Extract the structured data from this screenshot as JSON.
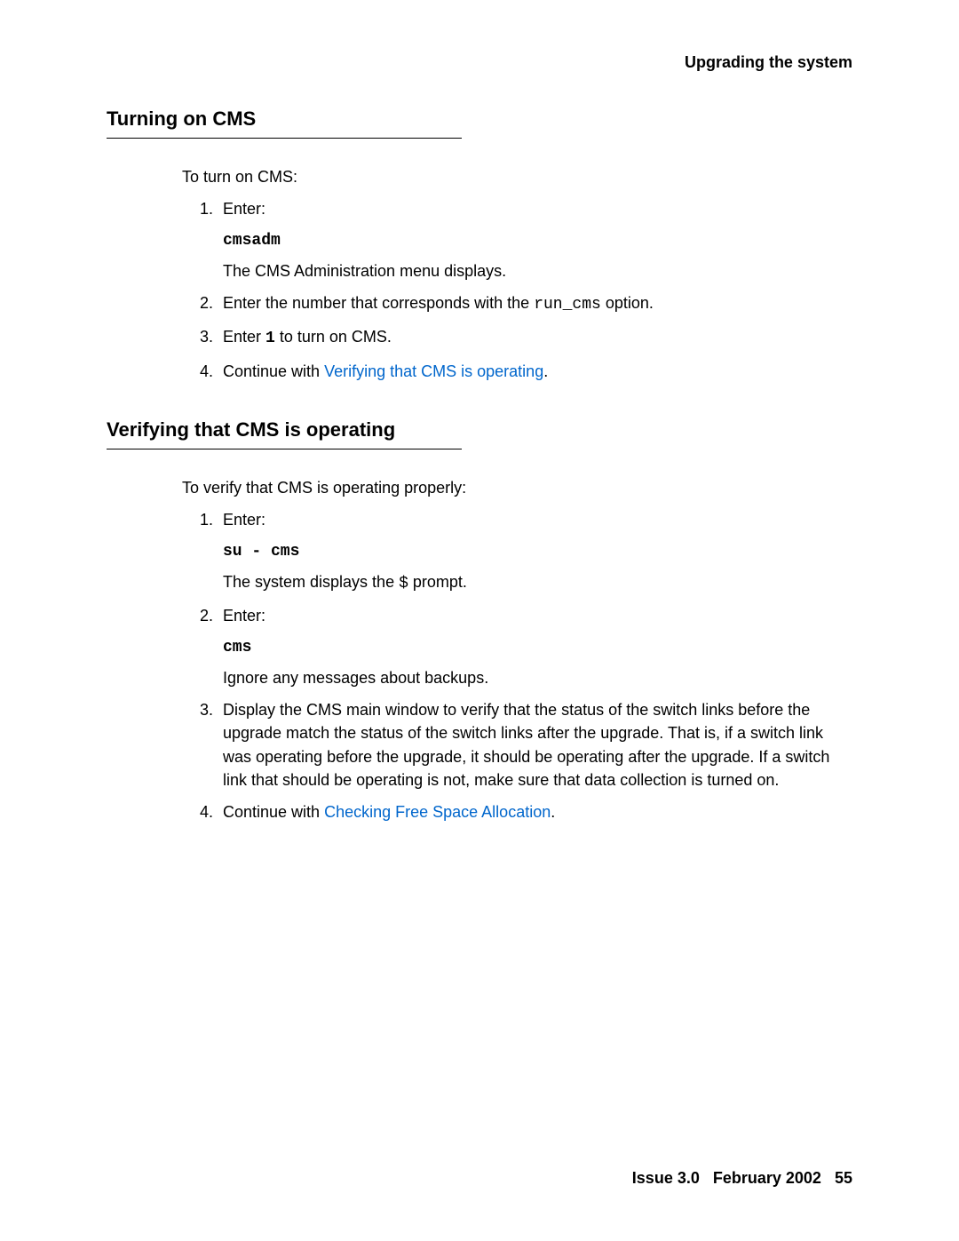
{
  "header": {
    "title": "Upgrading the system"
  },
  "s1": {
    "heading": "Turning on CMS",
    "intro": "To turn on CMS:",
    "i1": {
      "num": "1.",
      "text": "Enter:",
      "code": "cmsadm",
      "after": "The CMS Administration menu displays."
    },
    "i2": {
      "num": "2.",
      "pre": "Enter the number that corresponds with the ",
      "code": "run_cms",
      "post": " option."
    },
    "i3": {
      "num": "3.",
      "pre": "Enter ",
      "code": "1",
      "post": " to turn on CMS."
    },
    "i4": {
      "num": "4.",
      "pre": "Continue with ",
      "link": "Verifying that CMS is operating",
      "post": "."
    }
  },
  "s2": {
    "heading": "Verifying that CMS is operating",
    "intro": "To verify that CMS is operating properly:",
    "i1": {
      "num": "1.",
      "text": "Enter:",
      "code": "su - cms",
      "after_pre": "The system displays the ",
      "after_code": "$",
      "after_post": " prompt."
    },
    "i2": {
      "num": "2.",
      "text": "Enter:",
      "code": "cms",
      "after": "Ignore any messages about backups."
    },
    "i3": {
      "num": "3.",
      "text": "Display the CMS main window to verify that the status of the switch links before the upgrade match the status of the switch links after the upgrade. That is, if a switch link was operating before the upgrade, it should be operating after the upgrade. If a switch link that should be operating is not, make sure that data collection is turned on."
    },
    "i4": {
      "num": "4.",
      "pre": "Continue with ",
      "link": "Checking Free Space Allocation",
      "post": "."
    }
  },
  "footer": {
    "issue": "Issue 3.0",
    "date": "February 2002",
    "page": "55"
  }
}
